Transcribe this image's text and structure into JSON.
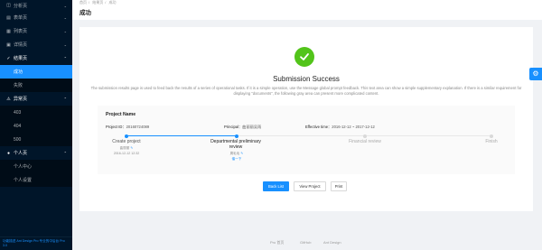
{
  "sidebar": {
    "items": [
      {
        "label": "分析页",
        "icon": "dashboard-icon",
        "open": false
      },
      {
        "label": "表单页",
        "icon": "form-icon",
        "open": false
      },
      {
        "label": "列表页",
        "icon": "table-icon",
        "open": false
      },
      {
        "label": "详情页",
        "icon": "profile-icon",
        "open": false
      },
      {
        "label": "结果页",
        "icon": "check-circle-icon",
        "open": true,
        "children": [
          {
            "label": "成功",
            "selected": true
          },
          {
            "label": "失败",
            "selected": false
          }
        ]
      },
      {
        "label": "异常页",
        "icon": "warning-icon",
        "open": true,
        "children": [
          {
            "label": "403"
          },
          {
            "label": "404"
          },
          {
            "label": "500"
          }
        ]
      },
      {
        "label": "个人页",
        "icon": "user-icon",
        "open": true,
        "children": [
          {
            "label": "个人中心"
          },
          {
            "label": "个人设置"
          }
        ]
      }
    ],
    "footer": "功能描述 Ant Design Pro 专业的中后台 Pro 3.0"
  },
  "breadcrumb": [
    "首页",
    "结果页",
    "成功"
  ],
  "page_title": "成功",
  "result": {
    "title": "Submission Success",
    "description": "The submission results page is used to feed back the results of a series of operational tasks. If it is a simple operation, use the Message global prompt feedback. This text area can show a simple supplementary explanation. If there is a similar requirement for displaying \"documents\", the following gray area can present more complicated content."
  },
  "project": {
    "name": "Project Name",
    "id_label": "Project ID：",
    "id_value": "20160724089",
    "principal_label": "Principal：",
    "principal_value": "曲丽丽吴雨",
    "time_label": "Effective time：",
    "time_value": "2016-12-12 ~ 2017-12-12"
  },
  "steps": [
    {
      "title": "Create project",
      "sub1": "曲丽丽",
      "sub2": "2016-12-12 12:32",
      "status": "finish"
    },
    {
      "title": "Departmental preliminary review",
      "sub1": "周毛毛",
      "sub2": "催一下",
      "status": "process"
    },
    {
      "title": "Financial review",
      "status": "wait"
    },
    {
      "title": "Finish",
      "status": "wait"
    }
  ],
  "actions": {
    "back": "Back List",
    "view": "View Project",
    "print": "Print"
  },
  "footer": {
    "links": [
      "Pro 首页",
      "GitHub",
      "Ant Design"
    ]
  },
  "colors": {
    "primary": "#1890ff",
    "success": "#52c41a",
    "sider_bg": "#001529"
  }
}
